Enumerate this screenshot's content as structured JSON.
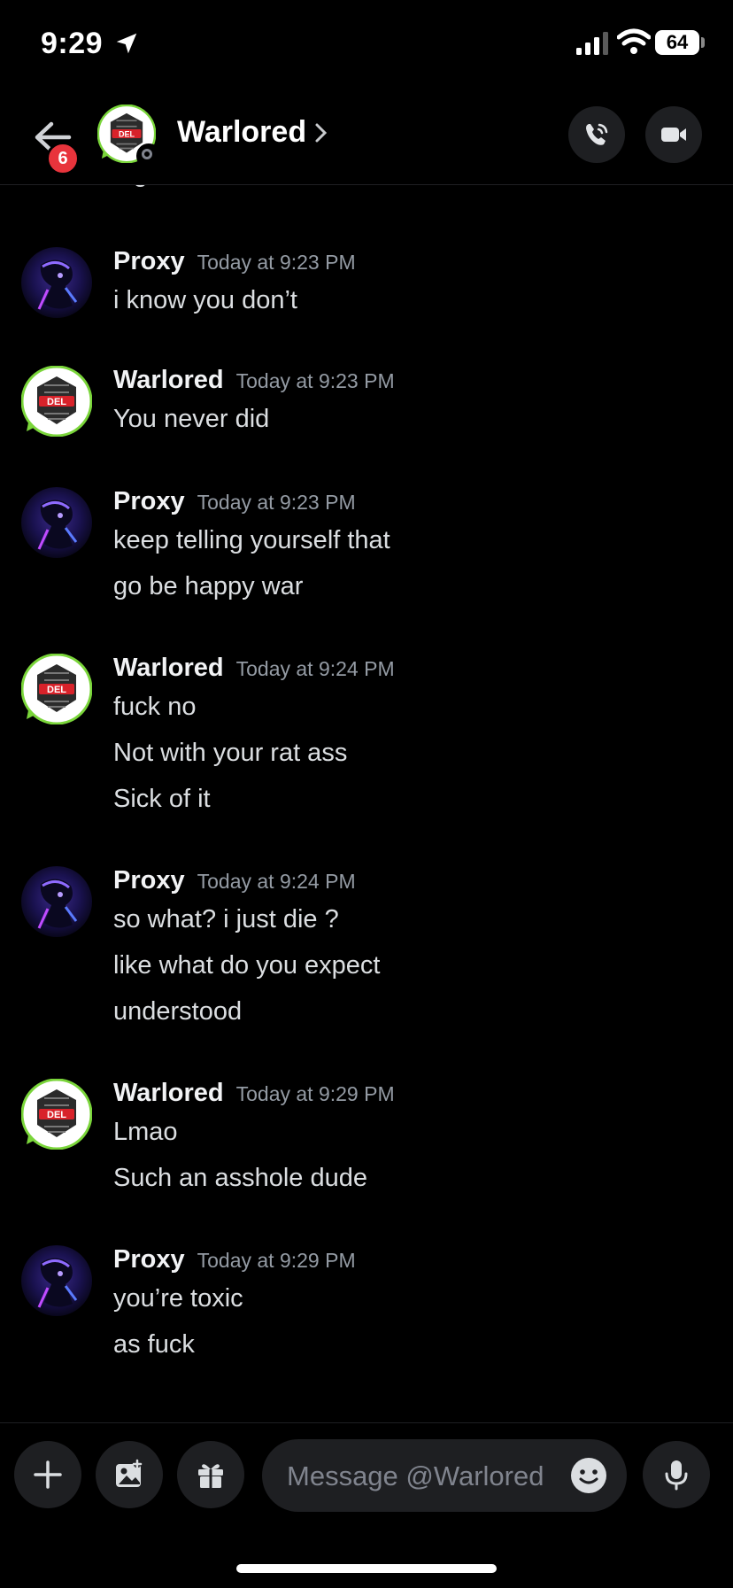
{
  "status_bar": {
    "time": "9:29",
    "battery": "64"
  },
  "header": {
    "badge_count": "6",
    "title": "Warlored"
  },
  "messages": {
    "cut_off_text": "idgaf",
    "groups": [
      {
        "author": "Proxy",
        "timestamp": "Today at 9:23 PM",
        "lines": [
          "i know you don’t"
        ]
      },
      {
        "author": "Warlored",
        "timestamp": "Today at 9:23 PM",
        "lines": [
          "You never did"
        ]
      },
      {
        "author": "Proxy",
        "timestamp": "Today at 9:23 PM",
        "lines": [
          "keep telling yourself that",
          "go be happy war"
        ]
      },
      {
        "author": "Warlored",
        "timestamp": "Today at 9:24 PM",
        "lines": [
          "fuck no",
          "Not with your rat ass",
          "Sick of it"
        ]
      },
      {
        "author": "Proxy",
        "timestamp": "Today at 9:24 PM",
        "lines": [
          "so what? i just die ?",
          "like what do you expect",
          "understood"
        ]
      },
      {
        "author": "Warlored",
        "timestamp": "Today at 9:29 PM",
        "lines": [
          "Lmao",
          "Such an asshole dude"
        ]
      },
      {
        "author": "Proxy",
        "timestamp": "Today at 9:29 PM",
        "lines": [
          "you’re toxic",
          "as fuck"
        ]
      }
    ]
  },
  "composer": {
    "placeholder": "Message @Warlored"
  },
  "colors": {
    "background": "#000000",
    "surface": "#1e1f22",
    "badge": "#e8343c",
    "muted_text": "#949ba4"
  }
}
